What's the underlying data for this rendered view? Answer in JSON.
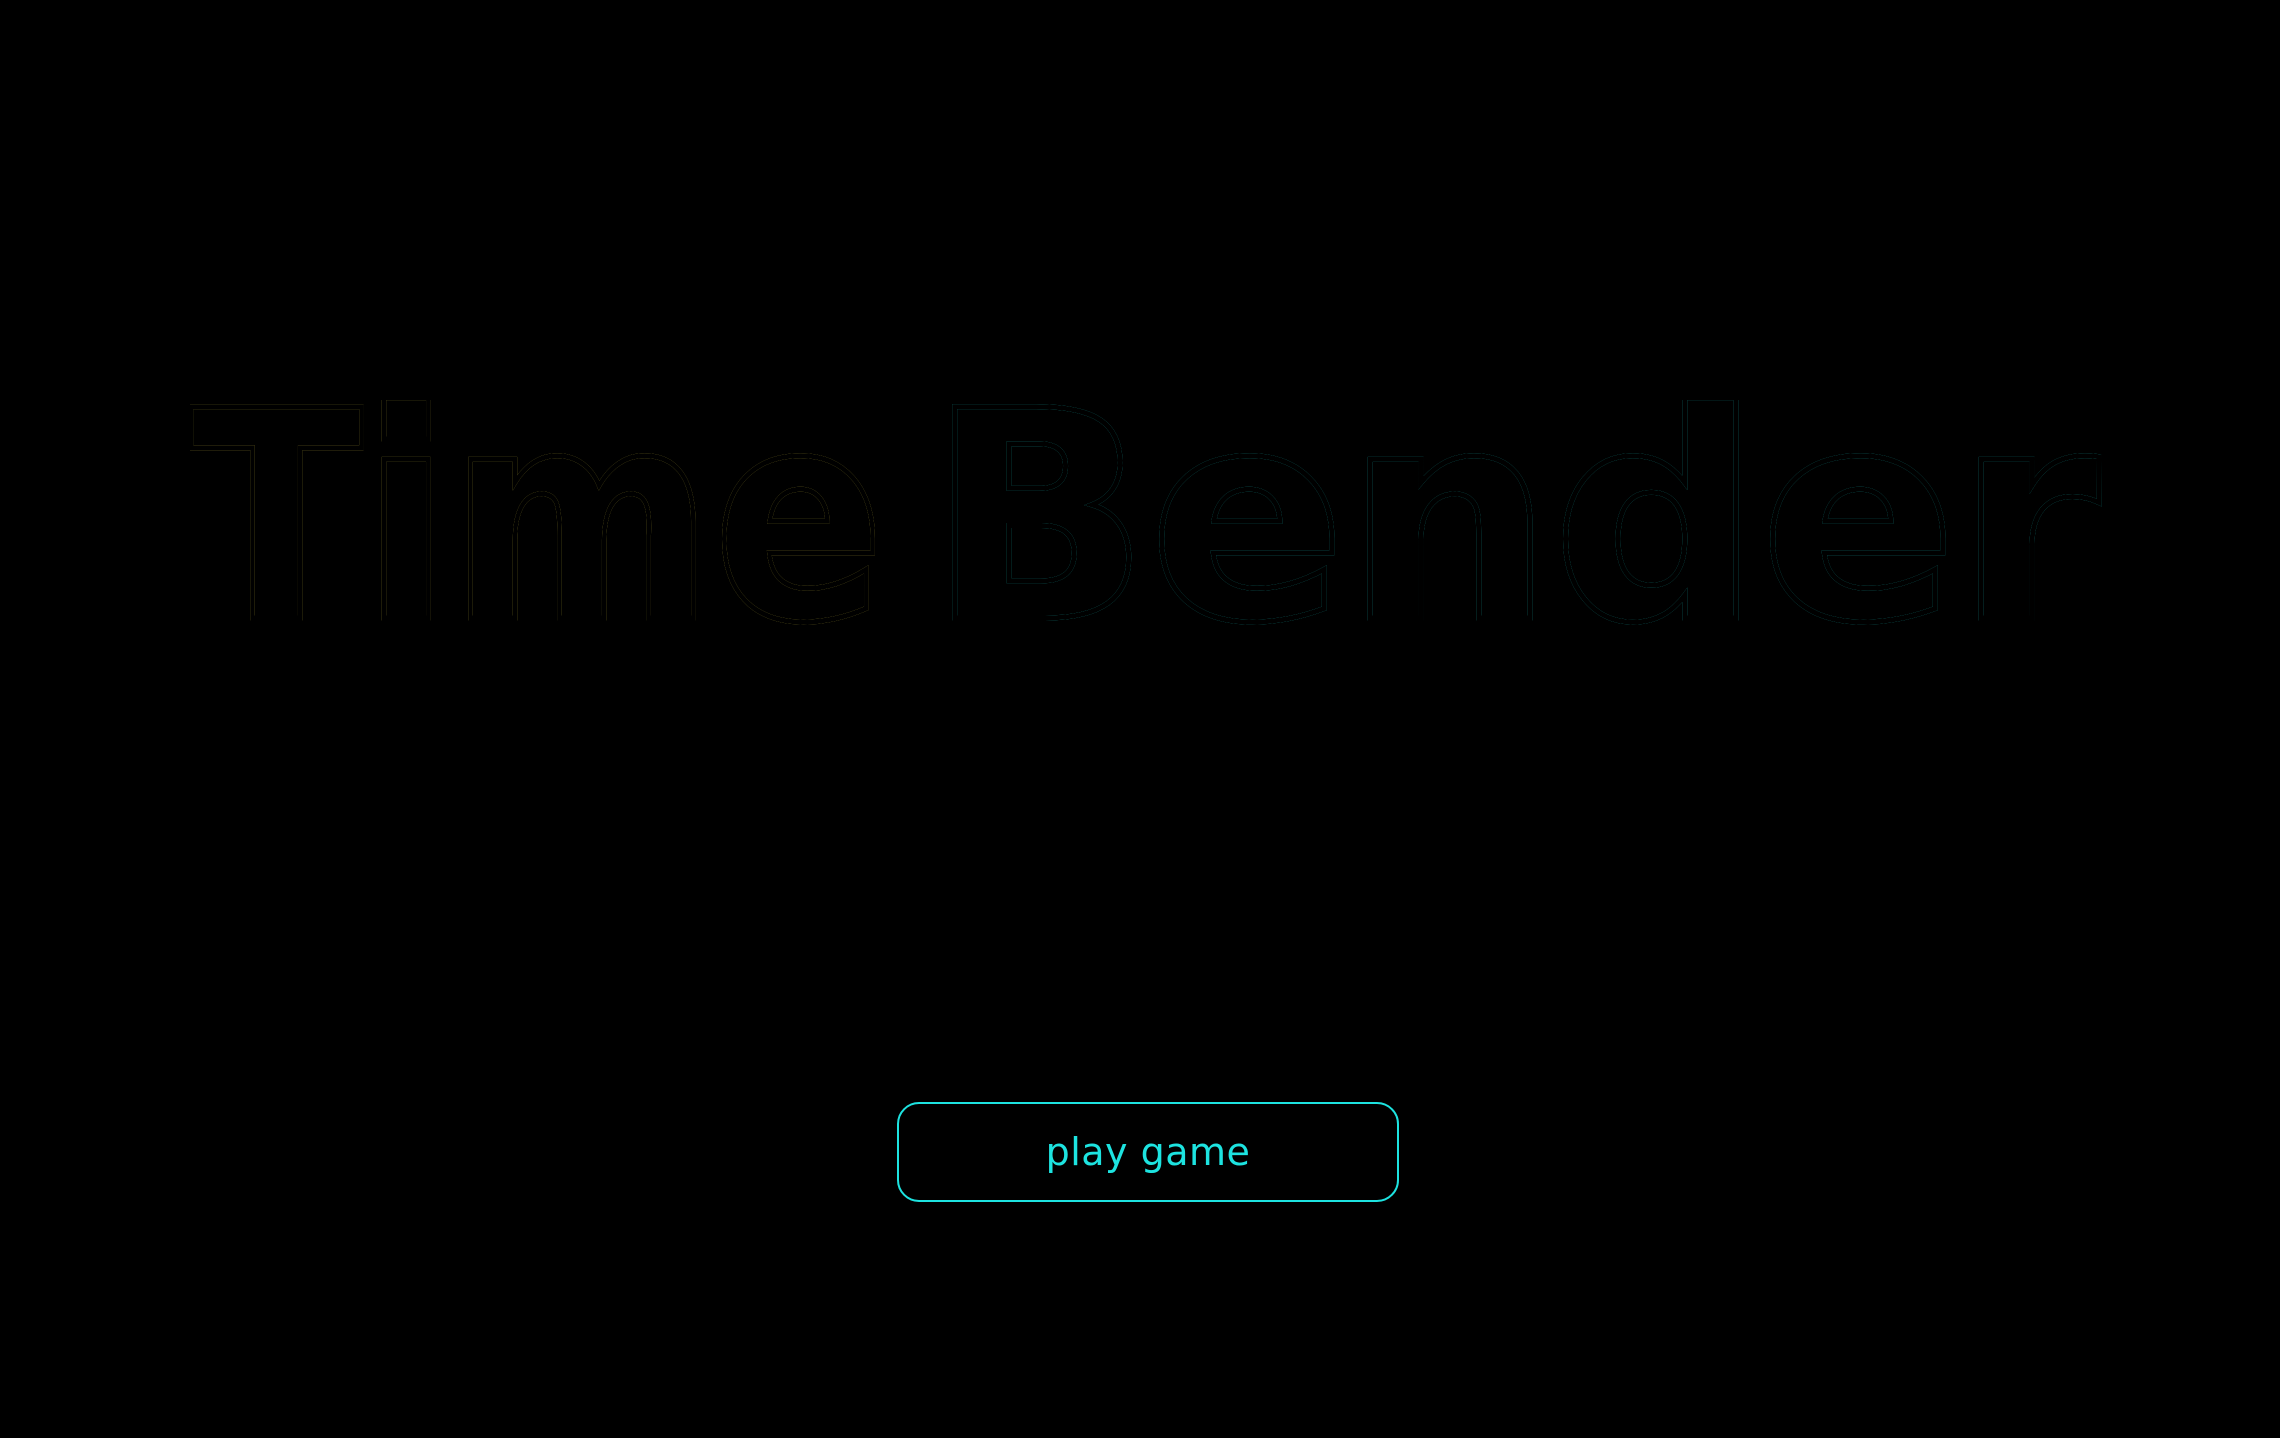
{
  "title": {
    "word1": "Time",
    "word2": "Bender",
    "word1_color": "#f7e64c",
    "word2_color": "#1ff3ee"
  },
  "play_button": {
    "label": "play game",
    "color": "#1de3e0"
  },
  "background_color": "#000000"
}
